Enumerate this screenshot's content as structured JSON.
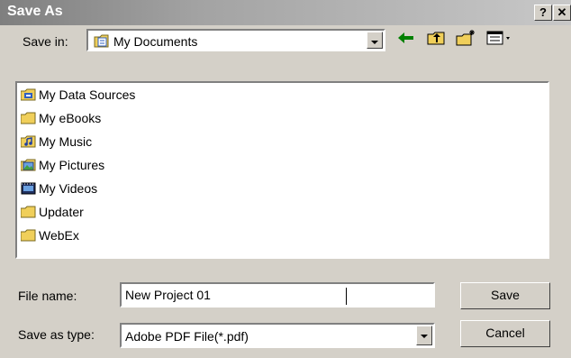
{
  "window": {
    "title": "Save As",
    "help_glyph": "?",
    "close_glyph": "✕"
  },
  "save_in": {
    "label": "Save in:",
    "value": "My Documents"
  },
  "toolbar": {
    "icons": [
      "back-icon",
      "up-folder-icon",
      "new-folder-icon",
      "views-menu-icon"
    ]
  },
  "files": [
    {
      "name": "My Data Sources",
      "icon": "data-sources-folder-icon"
    },
    {
      "name": "My eBooks",
      "icon": "folder-icon"
    },
    {
      "name": "My Music",
      "icon": "music-folder-icon"
    },
    {
      "name": "My Pictures",
      "icon": "pictures-folder-icon"
    },
    {
      "name": "My Videos",
      "icon": "videos-folder-icon"
    },
    {
      "name": "Updater",
      "icon": "folder-icon"
    },
    {
      "name": "WebEx",
      "icon": "folder-icon"
    }
  ],
  "file_name": {
    "label": "File name:",
    "value": "New Project 01"
  },
  "save_as_type": {
    "label": "Save as type:",
    "value": "Adobe PDF File(*.pdf)"
  },
  "buttons": {
    "save": "Save",
    "cancel": "Cancel"
  },
  "colors": {
    "accent_green": "#008000",
    "folder_yellow": "#f0cf5a",
    "title_text": "#ffffff"
  }
}
